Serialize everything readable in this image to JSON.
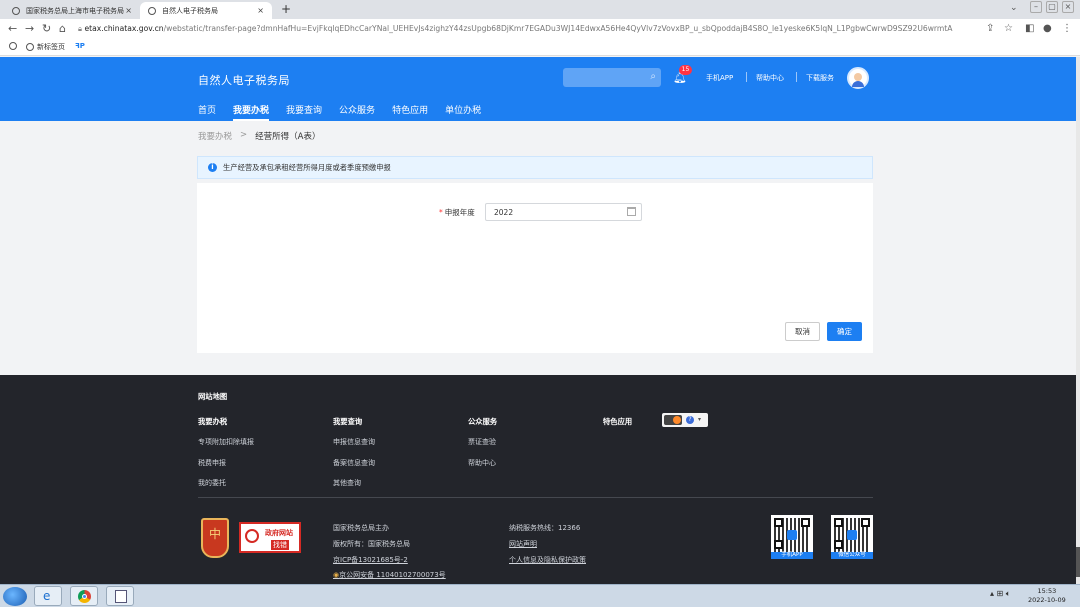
{
  "browser": {
    "tabs": [
      {
        "label": "国家税务总局上海市电子税务局",
        "close": "×"
      },
      {
        "label": "自然人电子税务局",
        "close": "×"
      }
    ],
    "new_tab": "+",
    "url_domain": "etax.chinatax.gov.cn",
    "url_path": "/webstatic/transfer-page?dmnHafHu=EvjFkqlqEDhcCarYNal_UEHEvJs4zighzY44zsUpgb68DjKmr7EGADu3WJ14EdwxA56He4QyVlv7zVovxBP_u_sbQpoddajB4S8O_le1yeske6K5lqN_L1PgbwCwrwD9SZ92U6wrmtA",
    "bookmarks": [
      {
        "label": "新标签页"
      },
      {
        "label": ""
      }
    ]
  },
  "header": {
    "site_title": "自然人电子税务局",
    "notification_count": "15",
    "links": [
      "手机APP",
      "帮助中心",
      "下载服务"
    ],
    "nav": [
      "首页",
      "我要办税",
      "我要查询",
      "公众服务",
      "特色应用",
      "单位办税"
    ],
    "active_nav": "我要办税"
  },
  "breadcrumb": {
    "parent": "我要办税",
    "separator": ">",
    "current": "经营所得（A表）"
  },
  "banner": {
    "text": "生产经营及承包承租经营所得月度或者季度预缴申报"
  },
  "form": {
    "required_mark": "*",
    "year_label": "申报年度",
    "year_value": "2022"
  },
  "actions": {
    "cancel": "取消",
    "confirm": "确定"
  },
  "footer": {
    "sitemap": "网站地图",
    "columns": [
      {
        "title": "我要办税",
        "items": [
          "专项附加扣除填报",
          "税费申报",
          "我的委托"
        ]
      },
      {
        "title": "我要查询",
        "items": [
          "申报信息查询",
          "备案信息查询",
          "其他查询"
        ]
      },
      {
        "title": "公众服务",
        "items": [
          "票证查验",
          "帮助中心"
        ]
      },
      {
        "title": "特色应用",
        "items": []
      }
    ],
    "toggle_mark": "?",
    "emblem_glyph": "中",
    "gov_logo_line1": "政府网站",
    "gov_logo_line2": "找错",
    "info_left": [
      "国家税务总局主办",
      "版权所有：国家税务总局",
      "京ICP备13021685号-2",
      "京公网安备 11040102700073号"
    ],
    "info_right": [
      "纳税服务热线：12366",
      "网站声明",
      "个人信息及隐私保护政策"
    ],
    "qr_captions": [
      "手机APP",
      "微信公众号"
    ]
  },
  "taskbar": {
    "time": "15:53",
    "date": "2022-10-09"
  },
  "colors": {
    "primary": "#1d7ff2",
    "footer_bg": "#23252b",
    "banner_bg": "#e8f4ff"
  }
}
